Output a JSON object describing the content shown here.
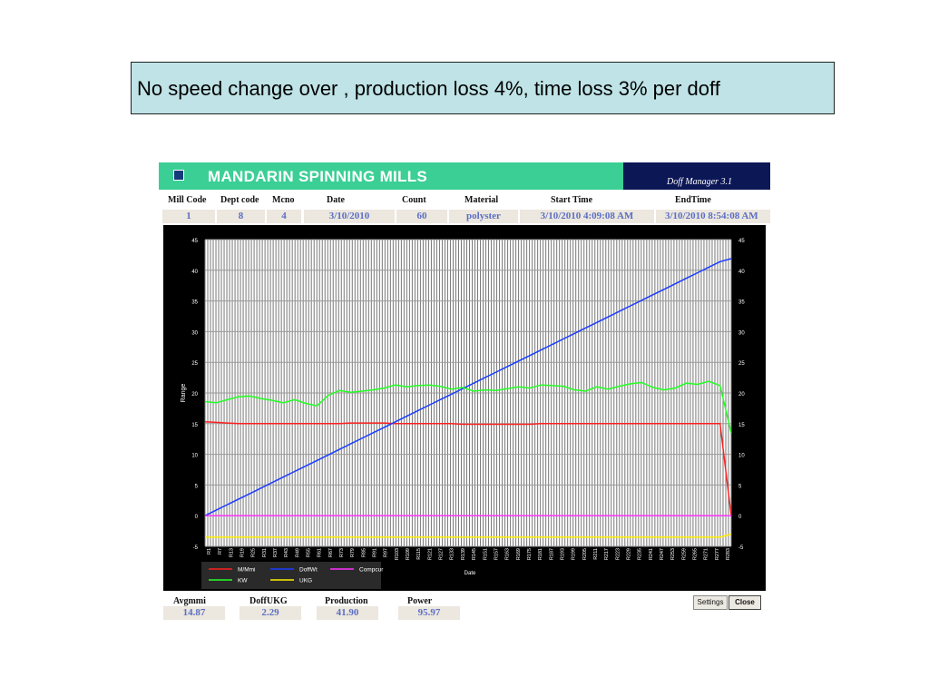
{
  "caption": "No speed change over , production loss 4%, time loss 3%  per doff",
  "app": {
    "title": "MANDARIN SPINNING MILLS",
    "version": "Doff Manager 3.1"
  },
  "info": {
    "labels": [
      "Mill Code",
      "Dept code",
      "Mcno",
      "Date",
      "Count",
      "Material",
      "Start Time",
      "EndTime"
    ],
    "values": [
      "1",
      "8",
      "4",
      "3/10/2010",
      "60",
      "polyster",
      "3/10/2010 4:09:08 AM",
      "3/10/2010 8:54:08 AM"
    ]
  },
  "stats": {
    "labels": [
      "Avgmmi",
      "DoffUKG",
      "Production",
      "Power"
    ],
    "values": [
      "14.87",
      "2.29",
      "41.90",
      "95.97"
    ]
  },
  "buttons": {
    "settings": "Settings",
    "close": "Close"
  },
  "colors": {
    "title_bg": "#3bcf95",
    "version_bg": "#0c1756",
    "value_text": "#5b6fc4"
  },
  "chart_data": {
    "type": "line",
    "xlabel": "Date",
    "ylabel": "Range",
    "ylim": [
      -5,
      45
    ],
    "yticks": [
      -5,
      0,
      5,
      10,
      15,
      20,
      25,
      30,
      35,
      40,
      45
    ],
    "grid": true,
    "legend_placement": "bottom-left",
    "x_tick_labels": [
      "R1",
      "R7",
      "R13",
      "R19",
      "R25",
      "R31",
      "R37",
      "R43",
      "R49",
      "R55",
      "R61",
      "R67",
      "R73",
      "R79",
      "R85",
      "R91",
      "R97",
      "R103",
      "R109",
      "R115",
      "R121",
      "R127",
      "R133",
      "R139",
      "R145",
      "R151",
      "R157",
      "R163",
      "R169",
      "R175",
      "R181",
      "R187",
      "R193",
      "R199",
      "R205",
      "R211",
      "R217",
      "R223",
      "R229",
      "R235",
      "R241",
      "R247",
      "R253",
      "R259",
      "R265",
      "R271",
      "R277",
      "R283"
    ],
    "series": [
      {
        "name": "M/Mmi",
        "color": "#ff2020",
        "values": [
          15.3,
          15.2,
          15.1,
          15.0,
          15.0,
          15.0,
          15.0,
          15.0,
          15.0,
          15.0,
          15.0,
          15.0,
          15.0,
          15.1,
          15.1,
          15.1,
          15.1,
          15.0,
          15.0,
          15.0,
          15.0,
          15.0,
          15.0,
          14.9,
          14.9,
          14.9,
          14.9,
          14.9,
          14.9,
          14.9,
          15.0,
          15.0,
          15.0,
          15.0,
          15.0,
          15.0,
          15.0,
          15.0,
          15.0,
          15.0,
          15.0,
          15.0,
          15.0,
          15.0,
          15.0,
          15.0,
          15.0,
          0.0
        ]
      },
      {
        "name": "DoffWt",
        "color": "#1a3cff",
        "values": [
          0.0,
          0.9,
          1.8,
          2.7,
          3.6,
          4.5,
          5.4,
          6.3,
          7.2,
          8.1,
          9.0,
          9.9,
          10.8,
          11.7,
          12.6,
          13.5,
          14.4,
          15.3,
          16.2,
          17.1,
          18.0,
          18.9,
          19.8,
          20.7,
          21.6,
          22.5,
          23.4,
          24.3,
          25.2,
          26.1,
          27.0,
          27.9,
          28.8,
          29.7,
          30.6,
          31.5,
          32.4,
          33.3,
          34.2,
          35.1,
          36.0,
          36.9,
          37.8,
          38.7,
          39.6,
          40.5,
          41.4,
          41.9
        ]
      },
      {
        "name": "Compcur",
        "color": "#ff33ff",
        "values": [
          0.0,
          0.0,
          0.0,
          0.0,
          0.0,
          0.0,
          0.0,
          0.0,
          0.0,
          0.0,
          0.0,
          0.0,
          0.0,
          0.0,
          0.0,
          0.0,
          0.0,
          0.0,
          0.0,
          0.0,
          0.0,
          0.0,
          0.0,
          0.0,
          0.0,
          0.0,
          0.0,
          0.0,
          0.0,
          0.0,
          0.0,
          0.0,
          0.0,
          0.0,
          0.0,
          0.0,
          0.0,
          0.0,
          0.0,
          0.0,
          0.0,
          0.0,
          0.0,
          0.0,
          0.0,
          0.0,
          0.0,
          0.0
        ]
      },
      {
        "name": "KW",
        "color": "#22ff22",
        "values": [
          18.6,
          18.4,
          18.9,
          19.4,
          19.5,
          19.1,
          18.8,
          18.4,
          18.9,
          18.3,
          17.9,
          19.6,
          20.4,
          20.1,
          20.3,
          20.5,
          20.8,
          21.3,
          21.0,
          21.2,
          21.3,
          21.1,
          20.6,
          20.9,
          20.3,
          20.5,
          20.4,
          20.7,
          21.0,
          20.8,
          21.3,
          21.2,
          21.1,
          20.5,
          20.3,
          21.0,
          20.6,
          21.1,
          21.5,
          21.7,
          20.9,
          20.5,
          20.8,
          21.6,
          21.4,
          21.9,
          21.2,
          13.5
        ]
      },
      {
        "name": "UKG",
        "color": "#ffee00",
        "values": [
          -3.5,
          -3.5,
          -3.5,
          -3.5,
          -3.5,
          -3.5,
          -3.5,
          -3.5,
          -3.5,
          -3.5,
          -3.5,
          -3.5,
          -3.5,
          -3.5,
          -3.5,
          -3.5,
          -3.5,
          -3.5,
          -3.5,
          -3.5,
          -3.5,
          -3.5,
          -3.5,
          -3.5,
          -3.5,
          -3.5,
          -3.5,
          -3.5,
          -3.5,
          -3.5,
          -3.5,
          -3.5,
          -3.5,
          -3.5,
          -3.5,
          -3.5,
          -3.5,
          -3.5,
          -3.5,
          -3.5,
          -3.5,
          -3.5,
          -3.5,
          -3.5,
          -3.5,
          -3.5,
          -3.5,
          -3.0
        ]
      }
    ]
  }
}
